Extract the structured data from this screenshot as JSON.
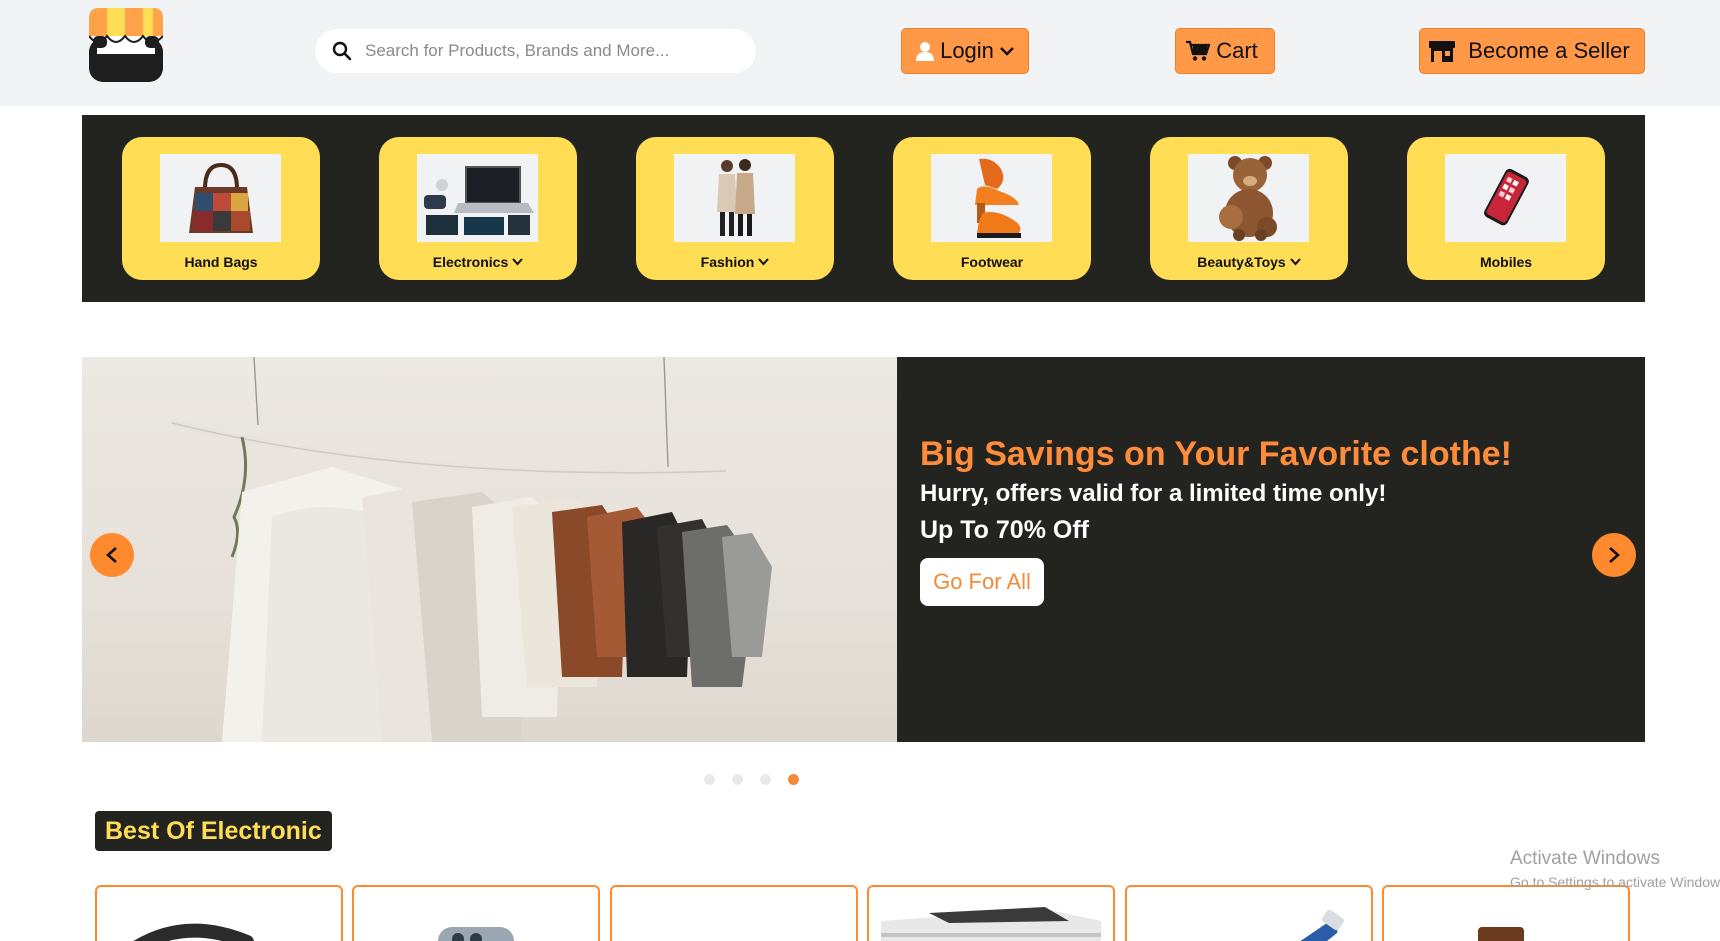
{
  "header": {
    "search_placeholder": "Search for Products, Brands and More...",
    "login_label": "Login",
    "cart_label": "Cart",
    "seller_label": "Become a Seller"
  },
  "categories": [
    {
      "label": "Hand Bags",
      "has_dropdown": false
    },
    {
      "label": "Electronics",
      "has_dropdown": true
    },
    {
      "label": "Fashion",
      "has_dropdown": true
    },
    {
      "label": "Footwear",
      "has_dropdown": false
    },
    {
      "label": "Beauty&Toys",
      "has_dropdown": true
    },
    {
      "label": "Mobiles",
      "has_dropdown": false
    }
  ],
  "hero": {
    "title": "Big Savings on Your Favorite clothe!",
    "subtitle": "Hurry, offers valid for a limited time only!",
    "discount": "Up To 70% Off",
    "cta_label": "Go For All",
    "slide_count": 4,
    "active_slide": 4
  },
  "section": {
    "title": "Best Of Electronic"
  },
  "watermark": {
    "line1": "Activate Windows",
    "line2": "Go to Settings to activate Windows."
  },
  "colors": {
    "accent_orange": "#ff9947",
    "category_yellow": "#ffdd55",
    "dark_bg": "#232320",
    "header_bg": "#f1f3f5"
  }
}
